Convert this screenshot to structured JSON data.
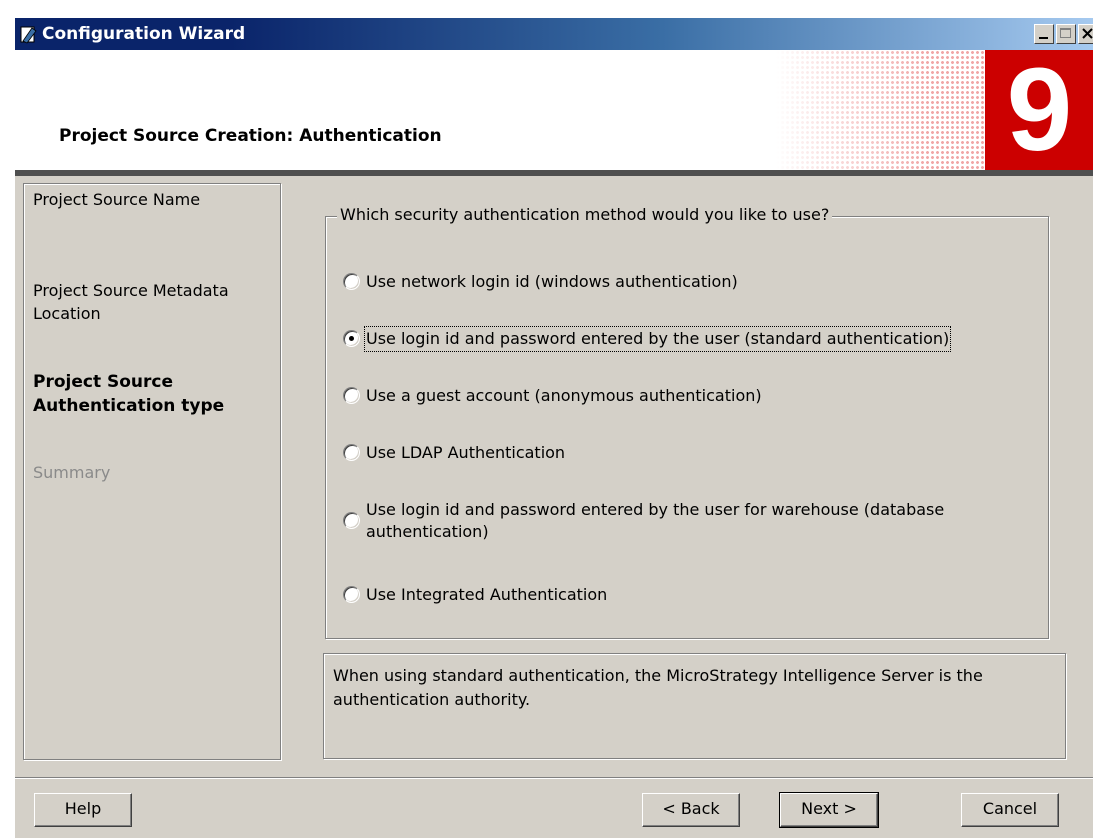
{
  "window": {
    "title": "Configuration Wizard"
  },
  "header": {
    "title": "Project Source Creation: Authentication",
    "badge": "9"
  },
  "nav": {
    "items": [
      {
        "label": "Project Source Name",
        "state": "normal"
      },
      {
        "label": "Project Source Metadata Location",
        "state": "normal"
      },
      {
        "label": "Project Source Authentication type",
        "state": "active"
      },
      {
        "label": "Summary",
        "state": "disabled"
      }
    ]
  },
  "auth": {
    "question": "Which security authentication method would you like to use?",
    "options": [
      {
        "label": "Use network login id (windows authentication)",
        "selected": false
      },
      {
        "label": "Use login id and password entered by the user (standard authentication)",
        "selected": true
      },
      {
        "label": "Use a guest account (anonymous authentication)",
        "selected": false
      },
      {
        "label": "Use LDAP Authentication",
        "selected": false
      },
      {
        "label": "Use login id and password entered by the user for warehouse (database authentication)",
        "selected": false
      },
      {
        "label": "Use Integrated Authentication",
        "selected": false
      }
    ]
  },
  "description": "When using standard authentication, the MicroStrategy Intelligence Server is the authentication authority.",
  "buttons": {
    "help": "Help",
    "back": "< Back",
    "next": "Next >",
    "cancel": "Cancel"
  },
  "colors": {
    "titlebar": "#0a246a",
    "brand_red": "#cc0000",
    "dialog_bg": "#d4d0c8"
  }
}
